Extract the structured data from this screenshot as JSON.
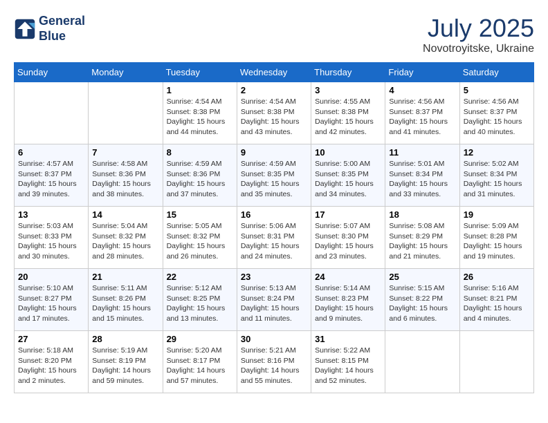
{
  "logo": {
    "line1": "General",
    "line2": "Blue"
  },
  "title": "July 2025",
  "subtitle": "Novotroyitske, Ukraine",
  "weekdays": [
    "Sunday",
    "Monday",
    "Tuesday",
    "Wednesday",
    "Thursday",
    "Friday",
    "Saturday"
  ],
  "weeks": [
    [
      {
        "day": "",
        "detail": ""
      },
      {
        "day": "",
        "detail": ""
      },
      {
        "day": "1",
        "detail": "Sunrise: 4:54 AM\nSunset: 8:38 PM\nDaylight: 15 hours and 44 minutes."
      },
      {
        "day": "2",
        "detail": "Sunrise: 4:54 AM\nSunset: 8:38 PM\nDaylight: 15 hours and 43 minutes."
      },
      {
        "day": "3",
        "detail": "Sunrise: 4:55 AM\nSunset: 8:38 PM\nDaylight: 15 hours and 42 minutes."
      },
      {
        "day": "4",
        "detail": "Sunrise: 4:56 AM\nSunset: 8:37 PM\nDaylight: 15 hours and 41 minutes."
      },
      {
        "day": "5",
        "detail": "Sunrise: 4:56 AM\nSunset: 8:37 PM\nDaylight: 15 hours and 40 minutes."
      }
    ],
    [
      {
        "day": "6",
        "detail": "Sunrise: 4:57 AM\nSunset: 8:37 PM\nDaylight: 15 hours and 39 minutes."
      },
      {
        "day": "7",
        "detail": "Sunrise: 4:58 AM\nSunset: 8:36 PM\nDaylight: 15 hours and 38 minutes."
      },
      {
        "day": "8",
        "detail": "Sunrise: 4:59 AM\nSunset: 8:36 PM\nDaylight: 15 hours and 37 minutes."
      },
      {
        "day": "9",
        "detail": "Sunrise: 4:59 AM\nSunset: 8:35 PM\nDaylight: 15 hours and 35 minutes."
      },
      {
        "day": "10",
        "detail": "Sunrise: 5:00 AM\nSunset: 8:35 PM\nDaylight: 15 hours and 34 minutes."
      },
      {
        "day": "11",
        "detail": "Sunrise: 5:01 AM\nSunset: 8:34 PM\nDaylight: 15 hours and 33 minutes."
      },
      {
        "day": "12",
        "detail": "Sunrise: 5:02 AM\nSunset: 8:34 PM\nDaylight: 15 hours and 31 minutes."
      }
    ],
    [
      {
        "day": "13",
        "detail": "Sunrise: 5:03 AM\nSunset: 8:33 PM\nDaylight: 15 hours and 30 minutes."
      },
      {
        "day": "14",
        "detail": "Sunrise: 5:04 AM\nSunset: 8:32 PM\nDaylight: 15 hours and 28 minutes."
      },
      {
        "day": "15",
        "detail": "Sunrise: 5:05 AM\nSunset: 8:32 PM\nDaylight: 15 hours and 26 minutes."
      },
      {
        "day": "16",
        "detail": "Sunrise: 5:06 AM\nSunset: 8:31 PM\nDaylight: 15 hours and 24 minutes."
      },
      {
        "day": "17",
        "detail": "Sunrise: 5:07 AM\nSunset: 8:30 PM\nDaylight: 15 hours and 23 minutes."
      },
      {
        "day": "18",
        "detail": "Sunrise: 5:08 AM\nSunset: 8:29 PM\nDaylight: 15 hours and 21 minutes."
      },
      {
        "day": "19",
        "detail": "Sunrise: 5:09 AM\nSunset: 8:28 PM\nDaylight: 15 hours and 19 minutes."
      }
    ],
    [
      {
        "day": "20",
        "detail": "Sunrise: 5:10 AM\nSunset: 8:27 PM\nDaylight: 15 hours and 17 minutes."
      },
      {
        "day": "21",
        "detail": "Sunrise: 5:11 AM\nSunset: 8:26 PM\nDaylight: 15 hours and 15 minutes."
      },
      {
        "day": "22",
        "detail": "Sunrise: 5:12 AM\nSunset: 8:25 PM\nDaylight: 15 hours and 13 minutes."
      },
      {
        "day": "23",
        "detail": "Sunrise: 5:13 AM\nSunset: 8:24 PM\nDaylight: 15 hours and 11 minutes."
      },
      {
        "day": "24",
        "detail": "Sunrise: 5:14 AM\nSunset: 8:23 PM\nDaylight: 15 hours and 9 minutes."
      },
      {
        "day": "25",
        "detail": "Sunrise: 5:15 AM\nSunset: 8:22 PM\nDaylight: 15 hours and 6 minutes."
      },
      {
        "day": "26",
        "detail": "Sunrise: 5:16 AM\nSunset: 8:21 PM\nDaylight: 15 hours and 4 minutes."
      }
    ],
    [
      {
        "day": "27",
        "detail": "Sunrise: 5:18 AM\nSunset: 8:20 PM\nDaylight: 15 hours and 2 minutes."
      },
      {
        "day": "28",
        "detail": "Sunrise: 5:19 AM\nSunset: 8:19 PM\nDaylight: 14 hours and 59 minutes."
      },
      {
        "day": "29",
        "detail": "Sunrise: 5:20 AM\nSunset: 8:17 PM\nDaylight: 14 hours and 57 minutes."
      },
      {
        "day": "30",
        "detail": "Sunrise: 5:21 AM\nSunset: 8:16 PM\nDaylight: 14 hours and 55 minutes."
      },
      {
        "day": "31",
        "detail": "Sunrise: 5:22 AM\nSunset: 8:15 PM\nDaylight: 14 hours and 52 minutes."
      },
      {
        "day": "",
        "detail": ""
      },
      {
        "day": "",
        "detail": ""
      }
    ]
  ]
}
